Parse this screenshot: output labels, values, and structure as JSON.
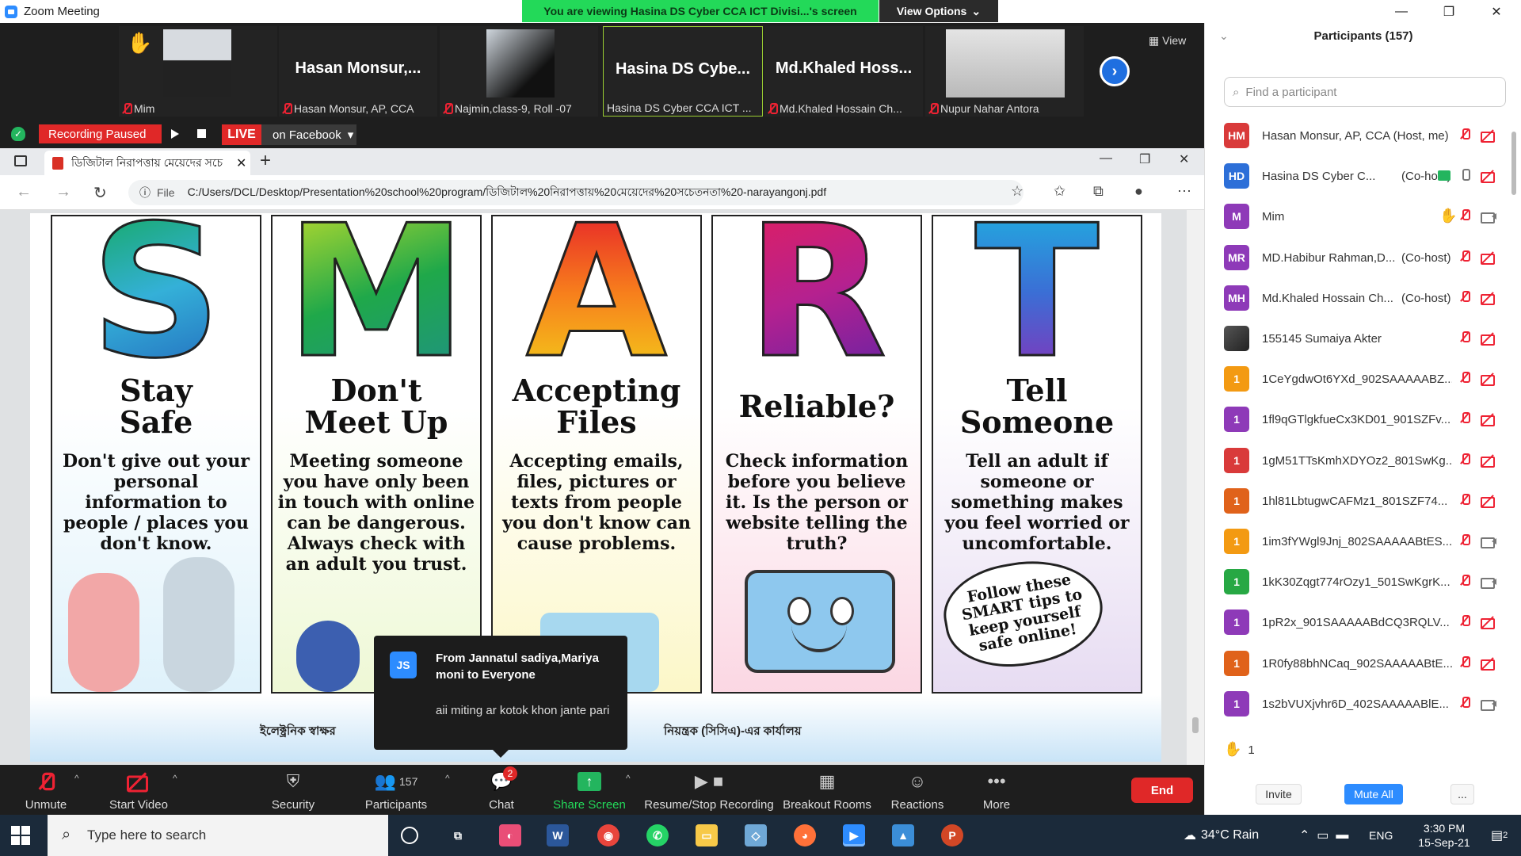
{
  "window": {
    "title": "Zoom Meeting"
  },
  "banner": {
    "viewing": "You are viewing Hasina DS Cyber CCA ICT Divisi...'s screen",
    "view_options": "View Options"
  },
  "strip": {
    "tiles": [
      {
        "label": "Mim",
        "big": ""
      },
      {
        "label": "Hasan Monsur, AP, CCA",
        "big": "Hasan  Monsur,..."
      },
      {
        "label": "Najmin,class-9, Roll -07",
        "big": ""
      },
      {
        "label": "Hasina DS Cyber CCA ICT ...",
        "big": "Hasina  DS  Cybe..."
      },
      {
        "label": "Md.Khaled Hossain Ch...",
        "big": "Md.Khaled  Hoss..."
      },
      {
        "label": "Nupur Nahar Antora",
        "big": ""
      }
    ],
    "view_label": "View"
  },
  "recording": {
    "paused_label": "Recording Paused",
    "live": "LIVE",
    "destination": "on Facebook"
  },
  "browser": {
    "tab_title": "ডিজিটাল নিরাপত্তায় মেয়েদের সচে",
    "file_label": "File",
    "url": "C:/Users/DCL/Desktop/Presentation%20school%20program/ডিজিটাল%20নিরাপত্তায়%20মেয়েদের%20সচেতনতা%20-narayangonj.pdf"
  },
  "poster": {
    "panels": [
      {
        "letter": "S",
        "head": "Stay\nSafe",
        "body": "Don't give out your personal information to people / places you don't know."
      },
      {
        "letter": "M",
        "head": "Don't\nMeet Up",
        "body": "Meeting someone you have only been in touch with online can be dangerous. Always check with an adult you trust."
      },
      {
        "letter": "A",
        "head": "Accepting\nFiles",
        "body": "Accepting emails, files, pictures or texts from people you don't know can cause problems."
      },
      {
        "letter": "R",
        "head": "Reliable?",
        "body": "Check information before you believe it. Is the person or website telling the truth?"
      },
      {
        "letter": "T",
        "head": "Tell\nSomeone",
        "body": "Tell an adult if someone or something makes you feel worried or uncomfortable."
      }
    ],
    "starburst": "Follow these SMART tips to keep yourself safe online!",
    "footer_left": "ইলেক্ট্রনিক স্বাক্ষর",
    "footer_right": "নিয়ন্ত্রক (সিসিএ)-এর কার্যালয়"
  },
  "chat_popup": {
    "initials": "JS",
    "from": "From Jannatul sadiya,Mariya moni to Everyone",
    "message": "aii miting ar kotok khon jante pari"
  },
  "toolbar": {
    "unmute": "Unmute",
    "start_video": "Start Video",
    "security": "Security",
    "participants": "Participants",
    "participants_count": "157",
    "chat": "Chat",
    "chat_badge": "2",
    "share_screen": "Share Screen",
    "recording": "Resume/Stop Recording",
    "breakout": "Breakout Rooms",
    "reactions": "Reactions",
    "more": "More",
    "end": "End"
  },
  "participants": {
    "header": "Participants (157)",
    "search_placeholder": "Find a participant",
    "rows": [
      {
        "initials": "HM",
        "color": "#d93a3a",
        "name": "Hasan Monsur, AP, CCA (Host, me)",
        "tag": "",
        "mic": "off",
        "cam": "off"
      },
      {
        "initials": "HD",
        "color": "#2d6fd8",
        "name": "Hasina DS Cyber C...",
        "tag": "(Co-host)",
        "mic": "on",
        "cam": "off",
        "sharing": true
      },
      {
        "initials": "M",
        "color": "#8e3ab8",
        "name": "Mim",
        "tag": "",
        "mic": "off",
        "cam": "on",
        "hand": true
      },
      {
        "initials": "MR",
        "color": "#8e3ab8",
        "name": "MD.Habibur Rahman,D...",
        "tag": "(Co-host)",
        "mic": "off",
        "cam": "off"
      },
      {
        "initials": "MH",
        "color": "#8e3ab8",
        "name": "Md.Khaled Hossain Ch...",
        "tag": "(Co-host)",
        "mic": "off",
        "cam": "off"
      },
      {
        "initials": "",
        "color": "#3a3a3a",
        "name": "155145 Sumaiya Akter",
        "tag": "",
        "mic": "off",
        "cam": "off"
      },
      {
        "initials": "1",
        "color": "#f39a12",
        "name": "1CeYgdwOt6YXd_902SAAAAABZ...",
        "tag": "",
        "mic": "off",
        "cam": "off"
      },
      {
        "initials": "1",
        "color": "#8e3ab8",
        "name": "1fl9qGTlgkfueCx3KD01_901SZFv...",
        "tag": "",
        "mic": "off",
        "cam": "off"
      },
      {
        "initials": "1",
        "color": "#d93a3a",
        "name": "1gM51TTsKmhXDYOz2_801SwKg...",
        "tag": "",
        "mic": "off",
        "cam": "off"
      },
      {
        "initials": "1",
        "color": "#e0621a",
        "name": "1hl81LbtugwCAFMz1_801SZF74...",
        "tag": "",
        "mic": "off",
        "cam": "off"
      },
      {
        "initials": "1",
        "color": "#f39a12",
        "name": "1im3fYWgl9Jnj_802SAAAAABtES...",
        "tag": "",
        "mic": "off",
        "cam": "on"
      },
      {
        "initials": "1",
        "color": "#27a844",
        "name": "1kK30Zqgt774rOzy1_501SwKgrK...",
        "tag": "",
        "mic": "off",
        "cam": "on"
      },
      {
        "initials": "1",
        "color": "#8e3ab8",
        "name": "1pR2x_901SAAAAABdCQ3RQLV...",
        "tag": "",
        "mic": "off",
        "cam": "off"
      },
      {
        "initials": "1",
        "color": "#e0621a",
        "name": "1R0fy88bhNCaq_902SAAAAABtE...",
        "tag": "",
        "mic": "off",
        "cam": "off"
      },
      {
        "initials": "1",
        "color": "#8e3ab8",
        "name": "1s2bVUXjvhr6D_402SAAAAABlE...",
        "tag": "",
        "mic": "off",
        "cam": "on"
      }
    ],
    "hand_count": "1",
    "invite": "Invite",
    "mute_all": "Mute All",
    "more": "..."
  },
  "taskbar": {
    "search_placeholder": "Type here to search",
    "weather": "34°C  Rain",
    "lang": "ENG",
    "time": "3:30 PM",
    "date": "15-Sep-21",
    "notifications": "2"
  }
}
